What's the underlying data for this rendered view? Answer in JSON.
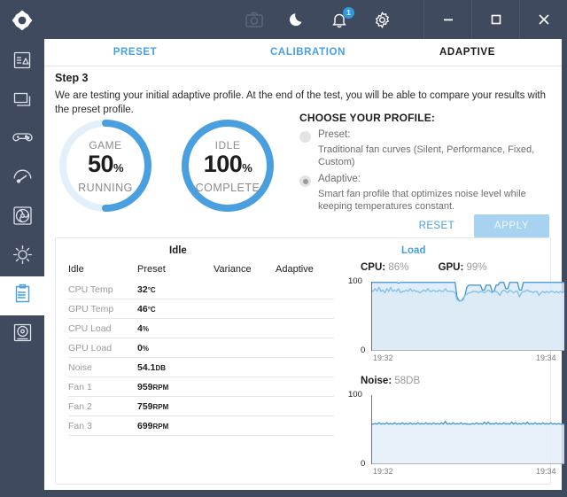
{
  "titlebar": {
    "logo_icon": "hexagon-logo-icon",
    "icons": [
      {
        "name": "camera-icon",
        "label": "Screenshot"
      },
      {
        "name": "moon-icon",
        "label": "Night mode"
      },
      {
        "name": "bell-icon",
        "label": "Notifications",
        "badge": "1"
      },
      {
        "name": "gear-icon",
        "label": "Settings"
      }
    ],
    "window_controls": [
      {
        "name": "minimize-button",
        "glyph": "minimize"
      },
      {
        "name": "maximize-button",
        "glyph": "maximize"
      },
      {
        "name": "close-button",
        "glyph": "close"
      }
    ]
  },
  "sidebar": {
    "items": [
      {
        "name": "sidebar-item-system-info",
        "icon": "system-info-icon",
        "active": false
      },
      {
        "name": "sidebar-item-display",
        "icon": "monitor-icon",
        "active": false
      },
      {
        "name": "sidebar-item-gaming",
        "icon": "gamepad-icon",
        "active": false
      },
      {
        "name": "sidebar-item-performance",
        "icon": "gauge-icon",
        "active": false
      },
      {
        "name": "sidebar-item-fan",
        "icon": "fan-icon",
        "active": false
      },
      {
        "name": "sidebar-item-brightness",
        "icon": "sun-icon",
        "active": false
      },
      {
        "name": "sidebar-item-report",
        "icon": "clipboard-icon",
        "active": true
      },
      {
        "name": "sidebar-item-storage",
        "icon": "disc-icon",
        "active": false
      }
    ]
  },
  "tabs": [
    {
      "label": "PRESET",
      "active": false
    },
    {
      "label": "CALIBRATION",
      "active": false
    },
    {
      "label": "ADAPTIVE",
      "active": true
    }
  ],
  "step": {
    "title": "Step 3",
    "description": "We are testing your initial adaptive profile. At the end of the test, you will be able to compare your results with the preset profile."
  },
  "gauges": [
    {
      "name": "game-gauge",
      "top_label": "GAME",
      "value": "50",
      "unit": "%",
      "bottom_label": "RUNNING",
      "percent": 50,
      "track_color": "#e3f0fa",
      "arc_color": "#4a9fe0"
    },
    {
      "name": "idle-gauge",
      "top_label": "IDLE",
      "value": "100",
      "unit": "%",
      "bottom_label": "COMPLETE",
      "percent": 100,
      "track_color": "#e3f0fa",
      "arc_color": "#4a9fe0"
    }
  ],
  "profile": {
    "heading": "CHOOSE YOUR PROFILE:",
    "options": [
      {
        "name": "Preset:",
        "description": "Traditional fan curves (Silent, Performance, Fixed, Custom)",
        "selected": false
      },
      {
        "name": "Adaptive:",
        "description": "Smart fan profile that optimizes noise level while keeping temperatures constant.",
        "selected": true
      }
    ],
    "reset_label": "RESET",
    "apply_label": "APPLY"
  },
  "bottom": {
    "idle_title": "Idle",
    "load_title": "Load",
    "table": {
      "columns": [
        "Idle",
        "Preset",
        "Variance",
        "Adaptive"
      ],
      "rows": [
        {
          "key": "CPU Temp",
          "preset": "32",
          "preset_unit": "°C",
          "variance": "",
          "adaptive": ""
        },
        {
          "key": "GPU Temp",
          "preset": "46",
          "preset_unit": "°C",
          "variance": "",
          "adaptive": ""
        },
        {
          "key": "CPU Load",
          "preset": "4",
          "preset_unit": "%",
          "variance": "",
          "adaptive": ""
        },
        {
          "key": "GPU Load",
          "preset": "0",
          "preset_unit": "%",
          "variance": "",
          "adaptive": ""
        },
        {
          "key": "Noise",
          "preset": "54.1",
          "preset_unit": "DB",
          "variance": "",
          "adaptive": ""
        },
        {
          "key": "Fan 1",
          "preset": "959",
          "preset_unit": "RPM",
          "variance": "",
          "adaptive": ""
        },
        {
          "key": "Fan 2",
          "preset": "759",
          "preset_unit": "RPM",
          "variance": "",
          "adaptive": ""
        },
        {
          "key": "Fan 3",
          "preset": "699",
          "preset_unit": "RPM",
          "variance": "",
          "adaptive": ""
        }
      ]
    }
  },
  "chart_data": [
    {
      "type": "area",
      "name": "load-chart",
      "title": "Load",
      "legend": [
        {
          "label": "CPU:",
          "value": "86%",
          "color": "#7ec0ea"
        },
        {
          "label": "GPU:",
          "value": "99%",
          "color": "#3d93d6"
        }
      ],
      "ylabel": "",
      "xlabel": "",
      "ylim": [
        0,
        100
      ],
      "ytick_labels": [
        "100",
        "0"
      ],
      "xtick_labels": [
        "19:32",
        "19:34"
      ],
      "grid": false,
      "fill_color": "#dceaf7",
      "series": [
        {
          "name": "GPU",
          "color": "#3d93d6",
          "values": [
            99,
            99,
            99,
            99,
            99,
            99,
            99,
            99,
            99,
            99,
            99,
            99,
            99,
            99,
            98,
            99,
            99,
            99,
            99,
            99,
            99,
            99,
            99,
            99,
            99,
            99,
            99,
            99,
            99,
            99,
            99,
            99,
            99,
            99,
            99,
            99,
            99,
            99,
            99,
            99,
            99,
            99,
            99,
            99,
            78,
            73,
            72,
            74,
            80,
            92,
            95,
            95,
            95,
            95,
            95,
            95,
            95,
            88,
            88,
            95,
            95,
            95,
            86,
            86,
            95,
            95,
            99,
            99,
            99,
            90,
            90,
            99,
            99,
            99,
            99,
            99,
            88,
            88,
            99,
            99,
            99,
            99,
            99,
            99,
            99,
            99,
            99,
            99,
            99,
            99,
            99,
            99,
            99,
            99,
            99,
            99,
            99,
            99,
            99,
            99
          ]
        },
        {
          "name": "CPU",
          "color": "#7ec0ea",
          "values": [
            88,
            86,
            90,
            86,
            92,
            86,
            88,
            84,
            90,
            86,
            92,
            86,
            88,
            86,
            90,
            84,
            86,
            86,
            88,
            86,
            90,
            86,
            88,
            86,
            86,
            84,
            86,
            88,
            86,
            90,
            86,
            86,
            88,
            86,
            86,
            88,
            86,
            86,
            90,
            86,
            86,
            86,
            86,
            84,
            74,
            72,
            72,
            76,
            80,
            82,
            84,
            84,
            86,
            86,
            86,
            84,
            86,
            86,
            84,
            86,
            88,
            86,
            84,
            86,
            86,
            84,
            80,
            86,
            88,
            86,
            84,
            88,
            86,
            84,
            86,
            86,
            78,
            84,
            86,
            86,
            88,
            86,
            86,
            84,
            86,
            86,
            80,
            84,
            86,
            84,
            86,
            84,
            86,
            86,
            84,
            86,
            84,
            86,
            84,
            86
          ]
        }
      ]
    },
    {
      "type": "area",
      "name": "noise-chart",
      "title": "",
      "legend": [
        {
          "label": "Noise:",
          "value": "58DB",
          "color": "#3d93d6"
        }
      ],
      "ylabel": "",
      "xlabel": "",
      "ylim": [
        0,
        100
      ],
      "ytick_labels": [
        "100",
        "0"
      ],
      "xtick_labels": [
        "19:32",
        "19:34"
      ],
      "grid": false,
      "fill_color": "#e4eff9",
      "series": [
        {
          "name": "Noise",
          "color": "#3d93d6",
          "values": [
            58,
            58,
            59,
            58,
            60,
            58,
            59,
            58,
            60,
            58,
            59,
            58,
            60,
            58,
            59,
            58,
            60,
            58,
            59,
            58,
            60,
            58,
            59,
            58,
            60,
            58,
            59,
            58,
            60,
            58,
            59,
            58,
            60,
            58,
            59,
            58,
            60,
            58,
            62,
            58,
            59,
            58,
            60,
            58,
            59,
            58,
            60,
            58,
            59,
            58,
            58,
            58,
            59,
            58,
            60,
            58,
            59,
            58,
            61,
            58,
            61,
            58,
            59,
            58,
            60,
            58,
            59,
            58,
            60,
            58,
            59,
            58,
            61,
            58,
            60,
            58,
            59,
            58,
            60,
            58,
            61,
            58,
            59,
            58,
            60,
            58,
            59,
            58,
            60,
            58,
            59,
            58,
            60,
            58,
            59,
            58,
            59,
            58,
            58,
            58
          ]
        }
      ]
    }
  ]
}
